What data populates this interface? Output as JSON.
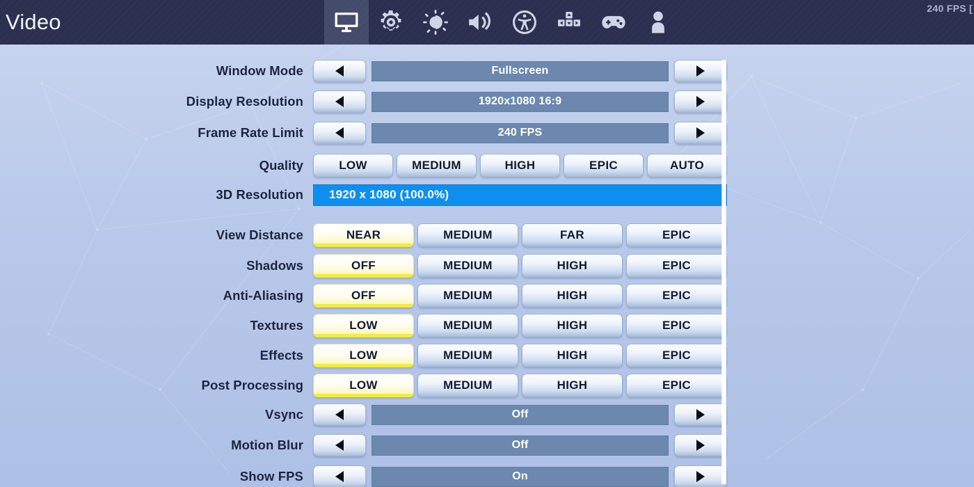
{
  "header": {
    "title": "Video",
    "fps_counter": "240 FPS [",
    "tabs": [
      {
        "icon": "monitor-icon",
        "name": "tab-video",
        "active": true
      },
      {
        "icon": "gear-icon",
        "name": "tab-game",
        "active": false
      },
      {
        "icon": "brightness-icon",
        "name": "tab-brightness",
        "active": false
      },
      {
        "icon": "volume-icon",
        "name": "tab-audio",
        "active": false
      },
      {
        "icon": "accessibility-icon",
        "name": "tab-accessibility",
        "active": false
      },
      {
        "icon": "keybinds-icon",
        "name": "tab-keyboard",
        "active": false
      },
      {
        "icon": "gamepad-icon",
        "name": "tab-controller",
        "active": false
      },
      {
        "icon": "account-icon",
        "name": "tab-account",
        "active": false
      }
    ]
  },
  "colors": {
    "header_bg": "#2b3050",
    "tab_active_bg": "#454b6b",
    "page_bg": "#b9c9ea",
    "value_bar": "#6c88ae",
    "slider_fill": "#0e8ff0",
    "selected_underline": "#f2ec3d",
    "label_text": "#1d2440"
  },
  "rows": [
    {
      "id": "window-mode",
      "label": "Window Mode",
      "type": "stepper",
      "value": "Fullscreen"
    },
    {
      "id": "display-resolution",
      "label": "Display Resolution",
      "type": "stepper",
      "value": "1920x1080 16:9"
    },
    {
      "id": "frame-rate-limit",
      "label": "Frame Rate Limit",
      "type": "stepper",
      "value": "240 FPS"
    },
    {
      "id": "quality",
      "label": "Quality",
      "type": "segmented",
      "options": [
        "LOW",
        "MEDIUM",
        "HIGH",
        "EPIC",
        "AUTO"
      ],
      "selected": -1
    },
    {
      "id": "3d-resolution",
      "label": "3D Resolution",
      "type": "slider",
      "value": "1920 x 1080 (100.0%)",
      "fill_percent": 100
    },
    {
      "id": "view-distance",
      "label": "View Distance",
      "type": "segmented",
      "options": [
        "NEAR",
        "MEDIUM",
        "FAR",
        "EPIC"
      ],
      "selected": 0
    },
    {
      "id": "shadows",
      "label": "Shadows",
      "type": "segmented",
      "options": [
        "OFF",
        "MEDIUM",
        "HIGH",
        "EPIC"
      ],
      "selected": 0
    },
    {
      "id": "anti-aliasing",
      "label": "Anti-Aliasing",
      "type": "segmented",
      "options": [
        "OFF",
        "MEDIUM",
        "HIGH",
        "EPIC"
      ],
      "selected": 0
    },
    {
      "id": "textures",
      "label": "Textures",
      "type": "segmented",
      "options": [
        "LOW",
        "MEDIUM",
        "HIGH",
        "EPIC"
      ],
      "selected": 0
    },
    {
      "id": "effects",
      "label": "Effects",
      "type": "segmented",
      "options": [
        "LOW",
        "MEDIUM",
        "HIGH",
        "EPIC"
      ],
      "selected": 0
    },
    {
      "id": "post-processing",
      "label": "Post Processing",
      "type": "segmented",
      "options": [
        "LOW",
        "MEDIUM",
        "HIGH",
        "EPIC"
      ],
      "selected": 0
    },
    {
      "id": "vsync",
      "label": "Vsync",
      "type": "stepper",
      "value": "Off"
    },
    {
      "id": "motion-blur",
      "label": "Motion Blur",
      "type": "stepper",
      "value": "Off"
    },
    {
      "id": "show-fps",
      "label": "Show FPS",
      "type": "stepper",
      "value": "On"
    }
  ],
  "row_layout": {
    "tops": [
      16,
      60,
      105,
      152,
      194,
      252,
      296,
      339,
      382,
      425,
      468,
      510,
      554,
      599
    ]
  }
}
